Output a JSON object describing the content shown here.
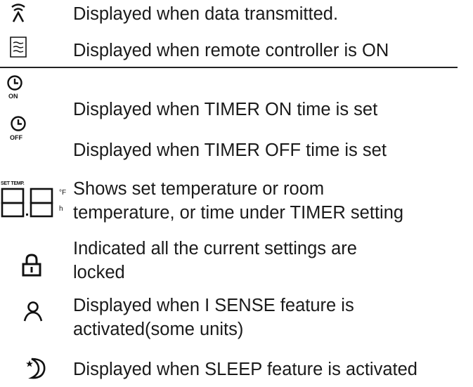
{
  "rows": [
    {
      "icon": "transmit-icon",
      "text": "Displayed when data transmitted."
    },
    {
      "icon": "remote-on-icon",
      "text": "Displayed when remote controller is ON"
    },
    {
      "icon": "timer-on-icon",
      "icon_label": "ON",
      "text": "Displayed when TIMER ON time is set"
    },
    {
      "icon": "timer-off-icon",
      "icon_label": "OFF",
      "text": "Displayed when TIMER OFF time is set"
    },
    {
      "icon": "temperature-display-icon",
      "icon_label": "SET TEMP.",
      "unit_f": "°F",
      "unit_h": "h",
      "text_line1": "Shows set temperature or room",
      "text_line2": "temperature, or time under TIMER setting"
    },
    {
      "icon": "lock-icon",
      "text_line1": "Indicated all the current settings are",
      "text_line2": "locked"
    },
    {
      "icon": "i-sense-person-icon",
      "text_line1": "Displayed when I SENSE feature is",
      "text_line2": "activated(some units)"
    },
    {
      "icon": "sleep-moon-icon",
      "text": "Displayed when SLEEP feature is activated"
    }
  ]
}
